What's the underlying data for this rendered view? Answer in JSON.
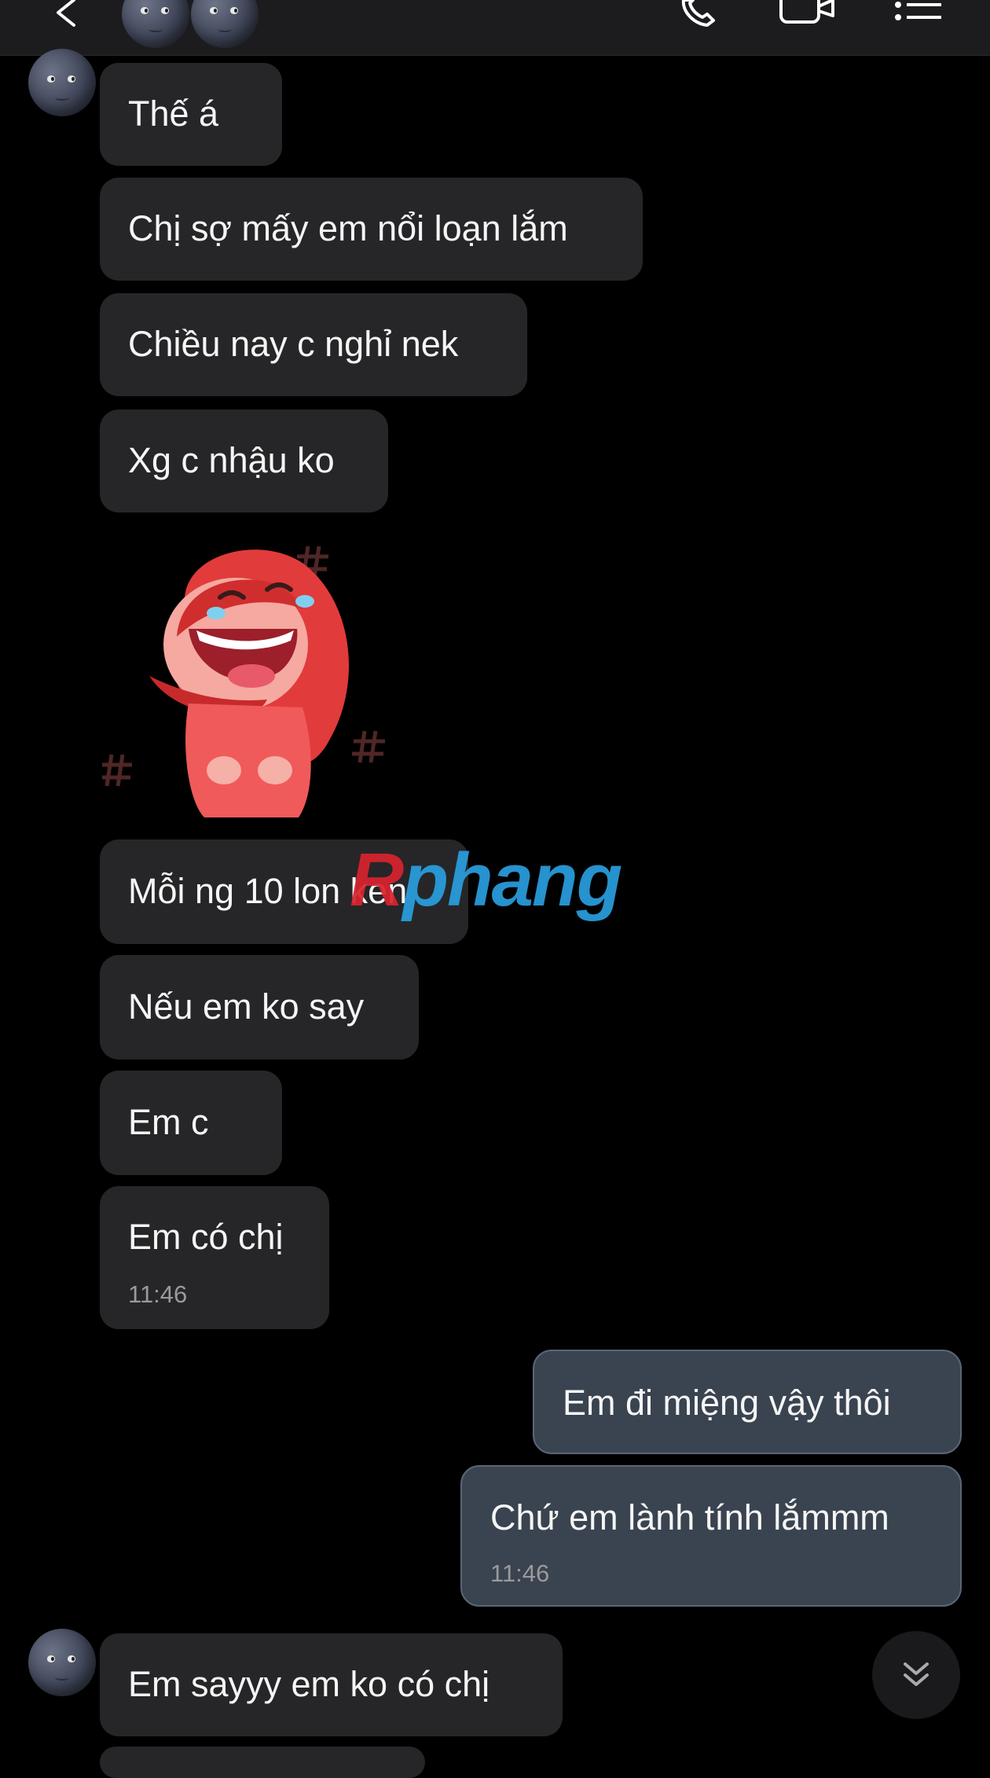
{
  "header": {
    "icons": [
      "back-icon",
      "phone-icon",
      "video-icon",
      "list-icon"
    ],
    "participants": [
      "moon-avatar",
      "moon-avatar"
    ]
  },
  "messages": [
    {
      "side": "in",
      "text": "Thế á"
    },
    {
      "side": "in",
      "text": "Chị sợ mấy em nổi loạn lắm"
    },
    {
      "side": "in",
      "text": "Chiều nay c nghỉ nek"
    },
    {
      "side": "in",
      "text": "Xg c nhậu ko"
    },
    {
      "side": "in",
      "type": "sticker",
      "sticker": "laughing-girl-red-hood"
    },
    {
      "side": "in",
      "text": "Mỗi ng 10 lon ken"
    },
    {
      "side": "in",
      "text": "Nếu em ko say"
    },
    {
      "side": "in",
      "text": "Em c"
    },
    {
      "side": "in",
      "text": "Em có chị",
      "time": "11:46"
    },
    {
      "side": "out",
      "text": "Em đi miệng vậy thôi"
    },
    {
      "side": "out",
      "text": "Chứ em lành tính lắmmm",
      "time": "11:46"
    },
    {
      "side": "in",
      "text": "Em sayyy em ko có chị"
    }
  ],
  "watermark": {
    "r": "R",
    "rest": "phang"
  },
  "colors": {
    "incoming_bubble": "#262628",
    "outgoing_bubble": "#3a4350",
    "background": "#000000",
    "watermark_blue": "#2a9fe0",
    "watermark_red": "#d9232e"
  },
  "scroll_button": {
    "icon": "chevron-double-down-icon"
  }
}
